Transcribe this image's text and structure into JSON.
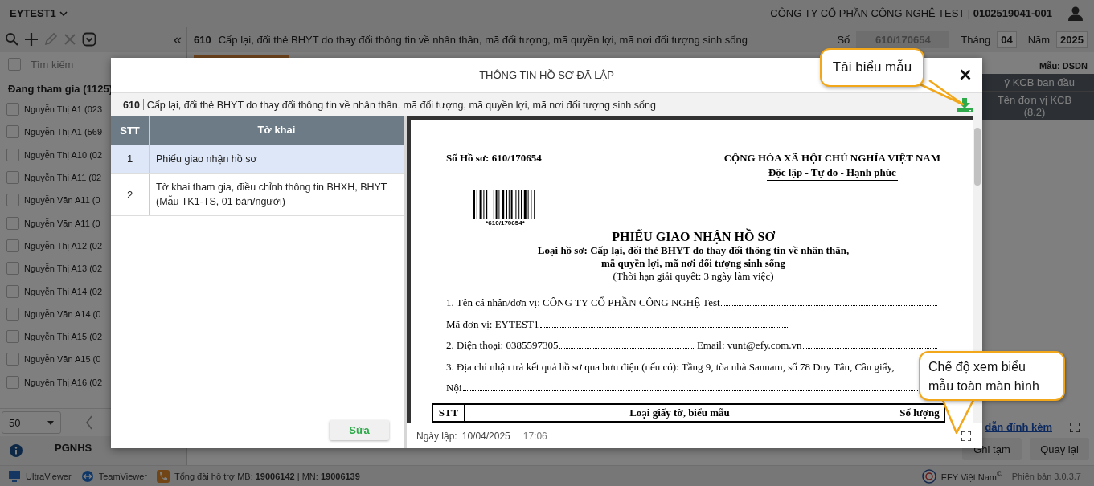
{
  "topbar": {
    "unit": "EYTEST1",
    "company": "CÔNG TY CỔ PHẦN CÔNG NGHỆ TEST | **0102519041-001**"
  },
  "toolbar": [
    {
      "kind": "search",
      "disabled": false
    },
    {
      "kind": "plus",
      "disabled": false
    },
    {
      "kind": "pencil",
      "disabled": true
    },
    {
      "kind": "close",
      "disabled": true
    },
    {
      "kind": "chevron",
      "disabled": false
    }
  ],
  "sidebar": {
    "collapse": "«",
    "select_all_checked": false,
    "search_placeholder": "Tìm kiếm",
    "group": "Đang tham gia (1125)",
    "items": [
      {
        "label": "Nguyễn Thị A1 (023",
        "checked": false
      },
      {
        "label": "Nguyễn Thị A1 (569",
        "checked": false
      },
      {
        "label": "Nguyễn Thị A10 (02",
        "checked": false
      },
      {
        "label": "Nguyễn Thị A11 (02",
        "checked": false
      },
      {
        "label": "Nguyễn Văn A11 (0",
        "checked": false
      },
      {
        "label": "Nguyễn Văn A11 (0",
        "checked": false
      },
      {
        "label": "Nguyễn Thị A12 (02",
        "checked": false
      },
      {
        "label": "Nguyễn Thị A13 (02",
        "checked": false
      },
      {
        "label": "Nguyễn Thị A14 (02",
        "checked": false
      },
      {
        "label": "Nguyễn Văn A14 (0",
        "checked": false
      },
      {
        "label": "Nguyễn Thị A15 (02",
        "checked": false
      },
      {
        "label": "Nguyễn Văn A15 (0",
        "checked": false
      },
      {
        "label": "Nguyễn Thị A16 (02",
        "checked": false
      }
    ],
    "page_size": "50",
    "tabs": [
      {
        "label": "PGNHS",
        "selected": false
      }
    ]
  },
  "header": {
    "code": "610",
    "title": "Cấp lại, đổi thẻ BHYT do thay đổi thông tin về nhân thân, mã đối tượng, mã quyền lợi, mã nơi đối tượng sinh sống",
    "number_label": "Số",
    "number": "610/170654",
    "month_label": "Tháng",
    "month": "04",
    "year_label": "Năm",
    "year": "2025"
  },
  "form_panel": {
    "template": "Mẫu: DSDN",
    "group_column": "ý KCB ban đầu",
    "column": "Tên đơn vị KCB (8.2)",
    "attachment_link": "dẫn đính kèm",
    "buttons": [
      "Ghi tạm",
      "Quay lại"
    ]
  },
  "modal": {
    "title": "THÔNG TIN HỒ SƠ ĐÃ LẬP",
    "code": "610",
    "subtitle": "Cấp lại, đổi thẻ BHYT do thay đổi thông tin về nhân thân, mã đối tượng, mã quyền lợi, mã nơi đối tượng sinh sống",
    "table": {
      "columns": [
        "STT",
        "Tờ khai"
      ],
      "rows": [
        {
          "stt": "1",
          "name": "Phiếu giao nhận hồ sơ",
          "selected": true
        },
        {
          "stt": "2",
          "name": "Tờ khai tham gia, điều chỉnh thông tin BHXH, BHYT (Mẫu TK1-TS, 01 bản/người)",
          "selected": false
        }
      ]
    },
    "edit_button": "Sửa",
    "date_label": "Ngày lập:",
    "date": "10/04/2025",
    "time": "17:06",
    "document": {
      "file_no": "Số Hồ sơ: 610/170654",
      "nation": "CỘNG HÒA XÃ HỘI CHỦ NGHĨA VIỆT NAM",
      "motto": "Độc lập - Tự do - Hạnh phúc",
      "barcode_text": "*610/170654*",
      "title": "PHIẾU GIAO NHẬN HỒ SƠ",
      "subtitle": [
        "Loại hồ sơ: Cấp lại, đổi thẻ BHYT do thay đổi thông tin về nhân thân,",
        "mã quyền lợi, mã nơi đối tượng sinh sống"
      ],
      "deadline": "(Thời hạn giải quyết: 3 ngày làm việc)",
      "lines": [
        {
          "parts": [
            "1. Tên cá nhân/đơn vị: CÔNG TY CỔ PHẦN CÔNG NGHỆ Test"
          ],
          "leader": true
        },
        {
          "parts": [
            "Mã đơn vị: EYTEST1"
          ],
          "leader": true
        },
        {
          "parts": [
            "2. Điện thoại: 0385597305",
            "Email: vunt@efy.com.vn"
          ],
          "leader": true
        },
        {
          "parts": [
            "3. Địa chỉ nhận trả kết quả hồ sơ qua bưu điện (nếu có): Tầng 9, tòa nhà Sannam, số 78 Duy Tân, Cầu giấy,"
          ],
          "leader": false
        },
        {
          "parts": [
            "Nội"
          ],
          "leader": true
        }
      ],
      "table_columns": [
        "STT",
        "Loại giấy tờ, biểu mẫu",
        "Số lượng"
      ]
    }
  },
  "callouts": [
    "Tải biểu mẫu",
    "Chế độ xem biểu mẫu toàn màn hình"
  ],
  "status_bar": {
    "tools": [
      "UltraViewer",
      "TeamViewer"
    ],
    "hotline": "Tổng đài hỗ trợ MB: **19006142** | MN: **19006139**",
    "brand": "EFY Việt Nam$^{©}$",
    "version": "Phiên bản 3.0.3.7"
  }
}
